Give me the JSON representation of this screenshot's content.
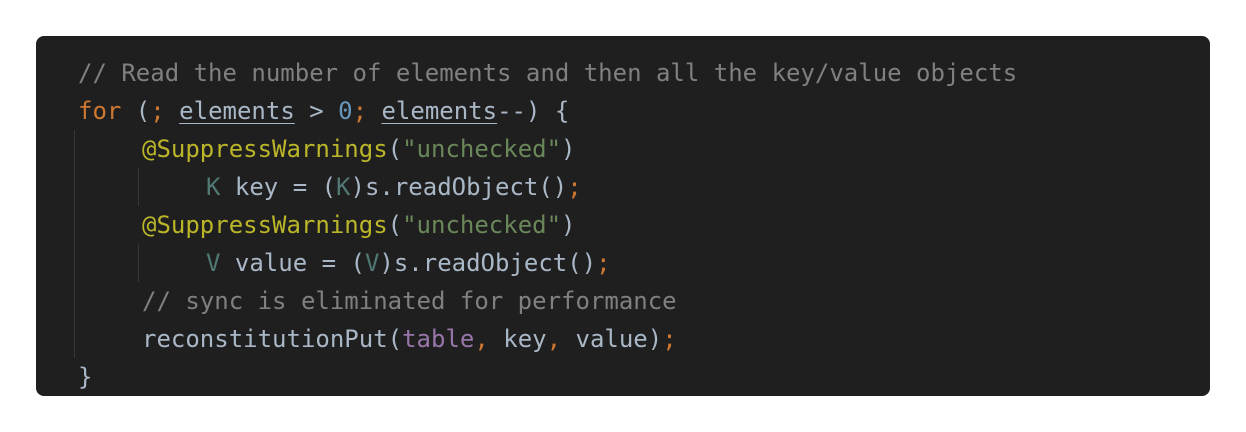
{
  "code": {
    "l1_comment": "// Read the number of elements and then all the key/value objects",
    "l2": {
      "kw_for": "for",
      "open": " (",
      "semi1": ";",
      "sp1": " ",
      "var1": "elements",
      "gt": " > ",
      "zero": "0",
      "semi2": ";",
      "sp2": " ",
      "var2": "elements",
      "dec": "--) {"
    },
    "l3": {
      "annotation": "@SuppressWarnings",
      "open": "(",
      "str": "\"unchecked\"",
      "close": ")"
    },
    "l4": {
      "type1": "K",
      "mid1": " key = (",
      "type2": "K",
      "call": ")s.readObject()",
      "semi": ";"
    },
    "l5": {
      "annotation": "@SuppressWarnings",
      "open": "(",
      "str": "\"unchecked\"",
      "close": ")"
    },
    "l6": {
      "type1": "V",
      "mid1": " value = (",
      "type2": "V",
      "call": ")s.readObject()",
      "semi": ";"
    },
    "l7_comment": "// sync is eliminated for performance",
    "l8": {
      "method": "reconstitutionPut(",
      "field": "table",
      "comma1": ",",
      "arg2": " key",
      "comma2": ",",
      "arg3": " value)",
      "semi": ";"
    },
    "l9_brace": "}"
  },
  "colors": {
    "background": "#1f1f1f",
    "comment": "#808080",
    "keyword": "#cc7832",
    "number": "#6897bb",
    "string": "#6a8759",
    "annotation": "#bbb529",
    "type": "#507874",
    "field": "#9876aa",
    "text": "#a9b7c6"
  }
}
